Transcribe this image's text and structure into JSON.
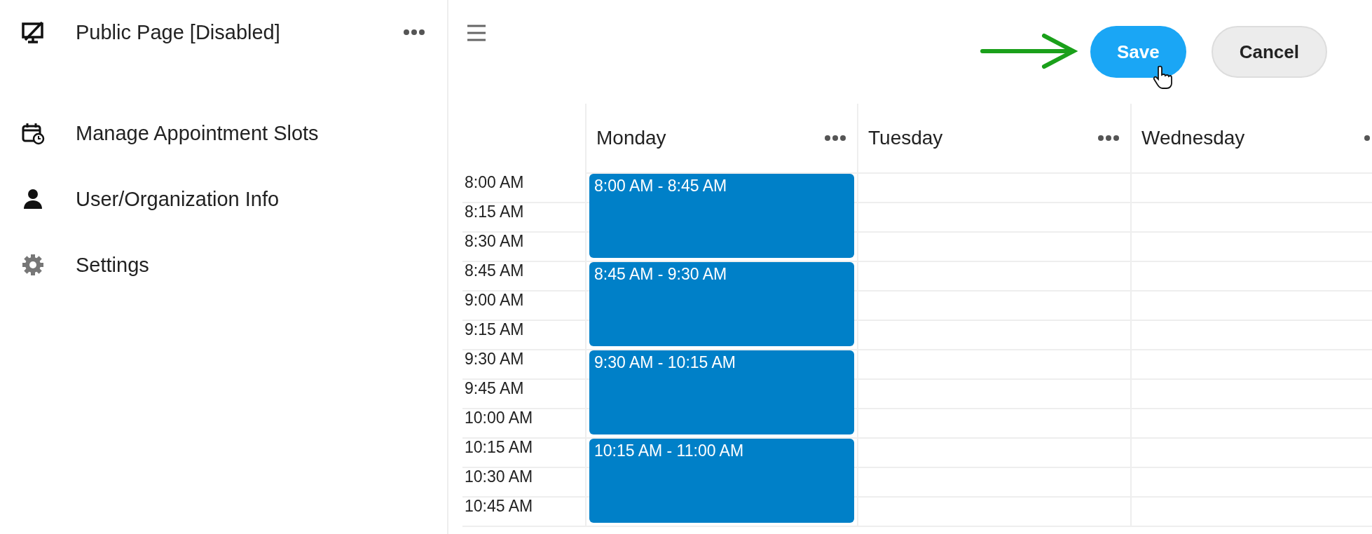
{
  "sidebar": {
    "header": {
      "label": "Public Page [Disabled]"
    },
    "items": [
      {
        "label": "Manage Appointment Slots"
      },
      {
        "label": "User/Organization Info"
      },
      {
        "label": "Settings"
      }
    ]
  },
  "toolbar": {
    "buttons": [
      {
        "label": "Save",
        "kind": "primary"
      },
      {
        "label": "Cancel",
        "kind": "secondary"
      }
    ]
  },
  "calendar": {
    "times": [
      "8:00 AM",
      "8:15 AM",
      "8:30 AM",
      "8:45 AM",
      "9:00 AM",
      "9:15 AM",
      "9:30 AM",
      "9:45 AM",
      "10:00 AM",
      "10:15 AM",
      "10:30 AM",
      "10:45 AM"
    ],
    "days": [
      {
        "name": "Monday",
        "events": [
          {
            "label": "8:00 AM - 8:45 AM"
          },
          {
            "label": "8:45 AM - 9:30 AM"
          },
          {
            "label": "9:30 AM - 10:15 AM"
          },
          {
            "label": "10:15 AM - 11:00 AM"
          }
        ]
      },
      {
        "name": "Tuesday"
      },
      {
        "name": "Wednesday"
      }
    ]
  }
}
